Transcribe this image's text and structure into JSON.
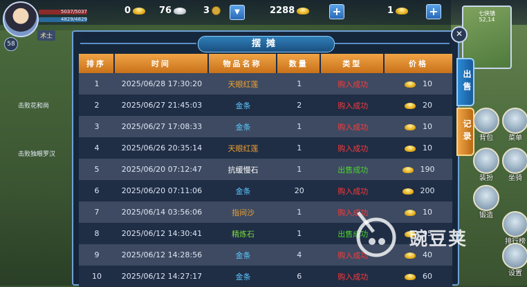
{
  "hud": {
    "hp_text": "5037/5037",
    "mp_text": "4829/4829",
    "class_tag": "术士",
    "level": "58",
    "gold_count": "0",
    "silver_count": "76",
    "coin_count": "3",
    "premium_gold": "2288",
    "ingot_count": "1",
    "minimap_name": "七侠镇",
    "minimap_coord": "52,14"
  },
  "side": {
    "left_lines": [
      "击败花和尚",
      "击败独眼罗汉"
    ],
    "right_icons": [
      "背包",
      "菜单",
      "装扮",
      "坐骑",
      "锻造",
      "排行榜",
      "设置"
    ]
  },
  "dialog": {
    "title": "摆摊",
    "close_glyph": "✕",
    "tab_sell": "出售",
    "tab_log": "记录",
    "headers": [
      "排序",
      "时间",
      "物品名称",
      "数量",
      "类型",
      "价格"
    ],
    "rows": [
      {
        "rank": "1",
        "time": "2025/06/28 17:30:20",
        "item": "天眼红莲",
        "item_color": "orange",
        "qty": "1",
        "type": "购入成功",
        "type_color": "red",
        "price": "10"
      },
      {
        "rank": "2",
        "time": "2025/06/27 21:45:03",
        "item": "金条",
        "item_color": "blue",
        "qty": "2",
        "type": "购入成功",
        "type_color": "red",
        "price": "20"
      },
      {
        "rank": "3",
        "time": "2025/06/27 17:08:33",
        "item": "金条",
        "item_color": "blue",
        "qty": "1",
        "type": "购入成功",
        "type_color": "red",
        "price": "10"
      },
      {
        "rank": "4",
        "time": "2025/06/26 20:35:14",
        "item": "天眼红莲",
        "item_color": "orange",
        "qty": "1",
        "type": "购入成功",
        "type_color": "red",
        "price": "10"
      },
      {
        "rank": "5",
        "time": "2025/06/20 07:12:47",
        "item": "抗缓慢石",
        "item_color": "white",
        "qty": "1",
        "type": "出售成功",
        "type_color": "green",
        "price": "190"
      },
      {
        "rank": "6",
        "time": "2025/06/20 07:11:06",
        "item": "金条",
        "item_color": "blue",
        "qty": "20",
        "type": "购入成功",
        "type_color": "red",
        "price": "200"
      },
      {
        "rank": "7",
        "time": "2025/06/14 03:56:06",
        "item": "指间沙",
        "item_color": "orange",
        "qty": "1",
        "type": "购入成功",
        "type_color": "red",
        "price": "10"
      },
      {
        "rank": "8",
        "time": "2025/06/12 14:30:41",
        "item": "精炼石",
        "item_color": "green",
        "qty": "1",
        "type": "出售成功",
        "type_color": "green",
        "price": "95"
      },
      {
        "rank": "9",
        "time": "2025/06/12 14:28:56",
        "item": "金条",
        "item_color": "blue",
        "qty": "4",
        "type": "购入成功",
        "type_color": "red",
        "price": "40"
      },
      {
        "rank": "10",
        "time": "2025/06/12 14:27:17",
        "item": "金条",
        "item_color": "blue",
        "qty": "6",
        "type": "购入成功",
        "type_color": "red",
        "price": "60"
      }
    ]
  },
  "watermark": {
    "text": "豌豆荚"
  },
  "colors": {
    "orange_item": "#f0a030",
    "blue_item": "#5ac8ff",
    "green_item": "#7ad83a",
    "buy_red": "#ff3a3a",
    "sell_green": "#4ad82a",
    "header_orange": "#e08a2a"
  }
}
